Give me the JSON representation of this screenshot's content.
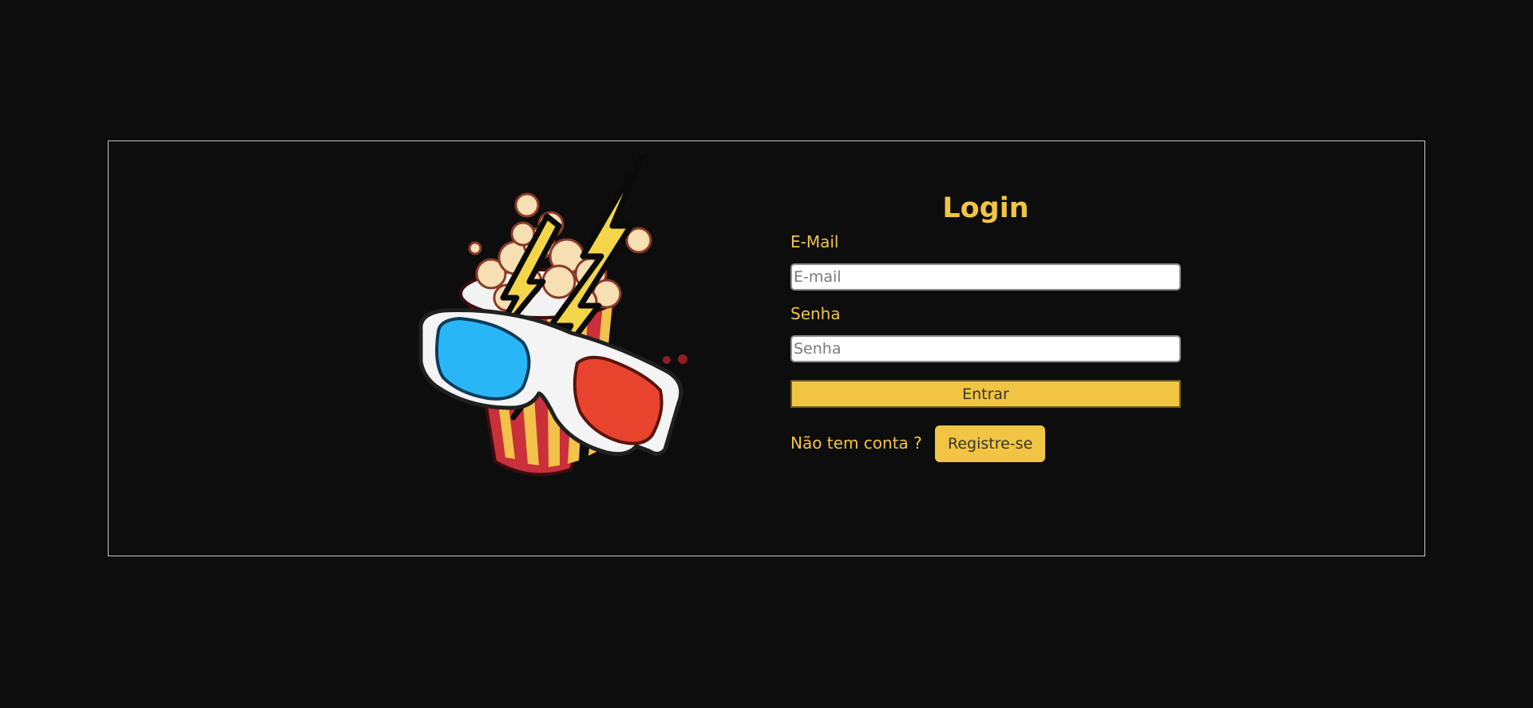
{
  "login": {
    "title": "Login",
    "email_label": "E-Mail",
    "email_placeholder": "E-mail",
    "email_value": "",
    "password_label": "Senha",
    "password_placeholder": "Senha",
    "password_value": "",
    "submit_label": "Entrar",
    "no_account_text": "Não tem conta ?",
    "register_label": "Registre-se"
  },
  "logo": {
    "icon": "popcorn-3d-glasses-logo"
  },
  "colors": {
    "background": "#0d0d0d",
    "accent": "#f2c443",
    "frame_border": "#c9c9c9",
    "button_text": "#333333"
  }
}
